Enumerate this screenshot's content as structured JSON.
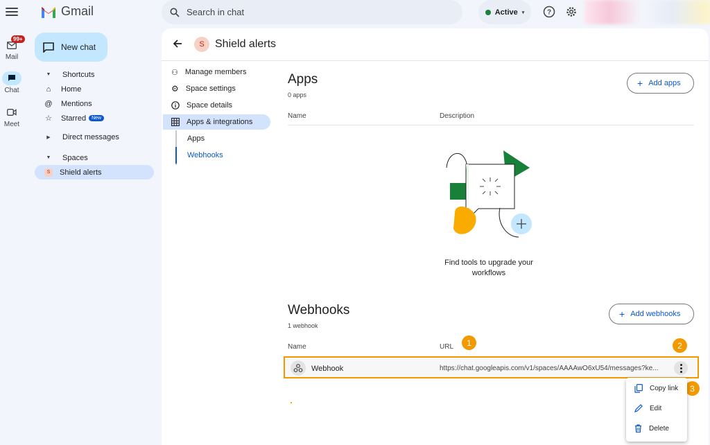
{
  "app": {
    "name": "Gmail"
  },
  "search": {
    "placeholder": "Search in chat"
  },
  "status": {
    "label": "Active",
    "color": "#188038"
  },
  "rail": [
    {
      "label": "Mail",
      "badge": "99+"
    },
    {
      "label": "Chat"
    },
    {
      "label": "Meet"
    }
  ],
  "sidebar": {
    "new_chat": "New chat",
    "shortcuts": "Shortcuts",
    "home": "Home",
    "mentions": "Mentions",
    "starred": "Starred",
    "new_badge": "New",
    "direct_messages": "Direct messages",
    "spaces": "Spaces",
    "space_item": "Shield alerts",
    "space_initial": "S"
  },
  "space": {
    "title": "Shield alerts",
    "initial": "S"
  },
  "settings_menu": {
    "manage_members": "Manage members",
    "space_settings": "Space settings",
    "space_details": "Space details",
    "apps_integrations": "Apps & integrations",
    "apps": "Apps",
    "webhooks": "Webhooks"
  },
  "apps_section": {
    "title": "Apps",
    "count": "0 apps",
    "add_button": "Add apps",
    "col_name": "Name",
    "col_description": "Description",
    "empty_text_line1": "Find tools to upgrade your",
    "empty_text_line2": "workflows"
  },
  "webhooks_section": {
    "title": "Webhooks",
    "count": "1 webhook",
    "add_button": "Add webhooks",
    "col_name": "Name",
    "col_url": "URL",
    "row": {
      "name": "Webhook",
      "url": "https://chat.googleapis.com/v1/spaces/AAAAwO6xU54/messages?ke..."
    }
  },
  "context_menu": {
    "copy_link": "Copy link",
    "edit": "Edit",
    "delete": "Delete"
  },
  "callouts": [
    "1",
    "2",
    "3"
  ],
  "colors": {
    "accent": "#0b57d0",
    "callout": "#f29900",
    "selected": "#d3e3fd"
  }
}
